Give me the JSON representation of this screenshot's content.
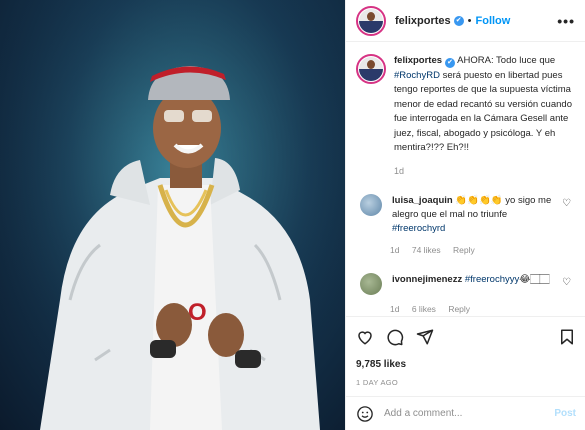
{
  "header": {
    "username": "felixportes",
    "verified_mark": "✔",
    "separator": "•",
    "follow_label": "Follow",
    "more_label": "•••"
  },
  "caption": {
    "username": "felixportes",
    "text_1": " AHORA: Todo luce que ",
    "hashtag": "#RochyRD",
    "text_2": " será puesto en libertad pues tengo reportes de que la supuesta víctima menor de edad recantó su versión cuando fue interrogada en la Cámara Gesell ante juez, fiscal, abogado y psicóloga. Y eh mentira?!?? Eh?!!",
    "age": "1d"
  },
  "comments": [
    {
      "username": "luisa_joaquin",
      "text_1": " 👏👏👏👏 yo sigo me alegro que el mal no triunfe ",
      "hashtag": "#freerochyrd",
      "age": "1d",
      "likes": "74 likes",
      "reply": "Reply",
      "avatar_color": "#5e86a8"
    },
    {
      "username": "ivonnejimenezz",
      "text_1": " ",
      "hashtag": "#freerochyyy",
      "text_2": "😂🏻🏻",
      "age": "1d",
      "likes": "6 likes",
      "reply": "Reply",
      "avatar_color": "#6a7d55"
    }
  ],
  "actions": {
    "icons": [
      "heart-icon",
      "comment-icon",
      "share-icon",
      "bookmark-icon"
    ],
    "likes": "9,785 likes",
    "age": "1 DAY AGO"
  },
  "add_comment": {
    "placeholder": "Add a comment...",
    "post_label": "Post"
  },
  "colors": {
    "accent": "#0095f6",
    "verified": "#3897f0",
    "hashtag": "#00376b",
    "muted": "#8e8e8e"
  }
}
